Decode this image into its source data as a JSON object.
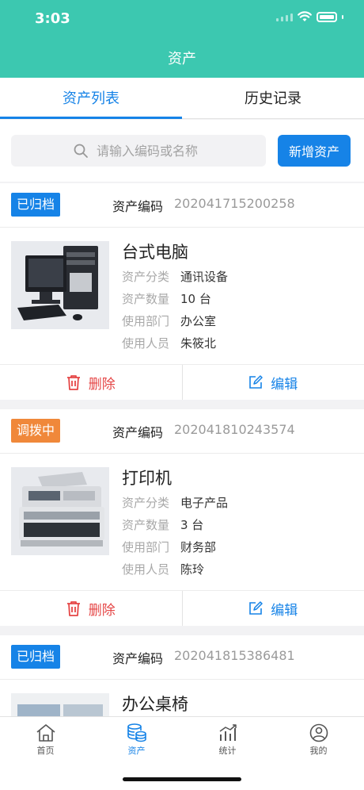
{
  "status_bar": {
    "time": "3:03"
  },
  "header": {
    "title": "资产"
  },
  "tabs": [
    {
      "label": "资产列表",
      "active": true
    },
    {
      "label": "历史记录",
      "active": false
    }
  ],
  "search": {
    "placeholder": "请输入编码或名称",
    "value": ""
  },
  "add_button": {
    "label": "新增资产"
  },
  "assets": [
    {
      "status": "已归档",
      "status_color": "#1683e7",
      "code_label": "资产编码",
      "code": "202041715200258",
      "name": "台式电脑",
      "category_label": "资产分类",
      "category": "通讯设备",
      "quantity_label": "资产数量",
      "quantity": "10 台",
      "department_label": "使用部门",
      "department": "办公室",
      "user_label": "使用人员",
      "user": "朱筱北",
      "delete_label": "删除",
      "edit_label": "编辑",
      "image_icon": "desktop-computer-image"
    },
    {
      "status": "调拨中",
      "status_color": "#f0883a",
      "code_label": "资产编码",
      "code": "202041810243574",
      "name": "打印机",
      "category_label": "资产分类",
      "category": "电子产品",
      "quantity_label": "资产数量",
      "quantity": "3 台",
      "department_label": "使用部门",
      "department": "财务部",
      "user_label": "使用人员",
      "user": "陈玲",
      "delete_label": "删除",
      "edit_label": "编辑",
      "image_icon": "printer-image"
    },
    {
      "status": "已归档",
      "status_color": "#1683e7",
      "code_label": "资产编码",
      "code": "202041815386481",
      "name": "办公桌椅",
      "image_icon": "office-desk-image"
    }
  ],
  "bottom_nav": [
    {
      "label": "首页",
      "icon": "home-icon",
      "active": false
    },
    {
      "label": "资产",
      "icon": "coins-icon",
      "active": true
    },
    {
      "label": "统计",
      "icon": "chart-icon",
      "active": false
    },
    {
      "label": "我的",
      "icon": "user-icon",
      "active": false
    }
  ]
}
